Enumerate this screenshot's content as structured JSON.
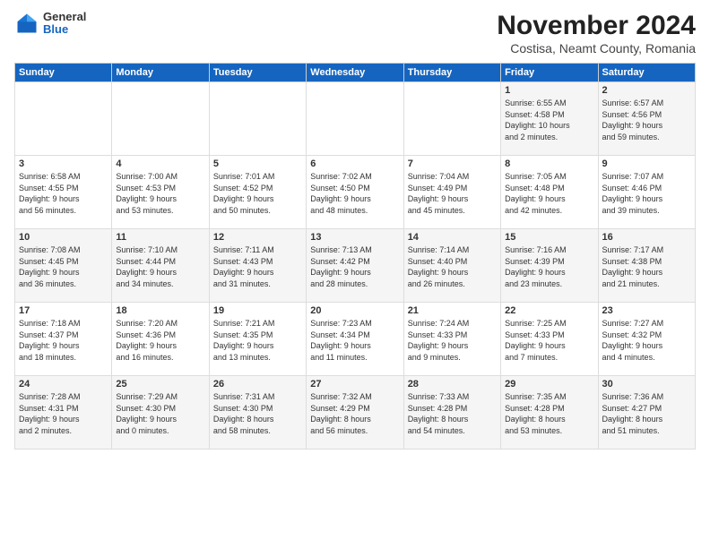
{
  "logo": {
    "general": "General",
    "blue": "Blue"
  },
  "title": "November 2024",
  "subtitle": "Costisa, Neamt County, Romania",
  "headers": [
    "Sunday",
    "Monday",
    "Tuesday",
    "Wednesday",
    "Thursday",
    "Friday",
    "Saturday"
  ],
  "weeks": [
    [
      {
        "day": "",
        "info": ""
      },
      {
        "day": "",
        "info": ""
      },
      {
        "day": "",
        "info": ""
      },
      {
        "day": "",
        "info": ""
      },
      {
        "day": "",
        "info": ""
      },
      {
        "day": "1",
        "info": "Sunrise: 6:55 AM\nSunset: 4:58 PM\nDaylight: 10 hours\nand 2 minutes."
      },
      {
        "day": "2",
        "info": "Sunrise: 6:57 AM\nSunset: 4:56 PM\nDaylight: 9 hours\nand 59 minutes."
      }
    ],
    [
      {
        "day": "3",
        "info": "Sunrise: 6:58 AM\nSunset: 4:55 PM\nDaylight: 9 hours\nand 56 minutes."
      },
      {
        "day": "4",
        "info": "Sunrise: 7:00 AM\nSunset: 4:53 PM\nDaylight: 9 hours\nand 53 minutes."
      },
      {
        "day": "5",
        "info": "Sunrise: 7:01 AM\nSunset: 4:52 PM\nDaylight: 9 hours\nand 50 minutes."
      },
      {
        "day": "6",
        "info": "Sunrise: 7:02 AM\nSunset: 4:50 PM\nDaylight: 9 hours\nand 48 minutes."
      },
      {
        "day": "7",
        "info": "Sunrise: 7:04 AM\nSunset: 4:49 PM\nDaylight: 9 hours\nand 45 minutes."
      },
      {
        "day": "8",
        "info": "Sunrise: 7:05 AM\nSunset: 4:48 PM\nDaylight: 9 hours\nand 42 minutes."
      },
      {
        "day": "9",
        "info": "Sunrise: 7:07 AM\nSunset: 4:46 PM\nDaylight: 9 hours\nand 39 minutes."
      }
    ],
    [
      {
        "day": "10",
        "info": "Sunrise: 7:08 AM\nSunset: 4:45 PM\nDaylight: 9 hours\nand 36 minutes."
      },
      {
        "day": "11",
        "info": "Sunrise: 7:10 AM\nSunset: 4:44 PM\nDaylight: 9 hours\nand 34 minutes."
      },
      {
        "day": "12",
        "info": "Sunrise: 7:11 AM\nSunset: 4:43 PM\nDaylight: 9 hours\nand 31 minutes."
      },
      {
        "day": "13",
        "info": "Sunrise: 7:13 AM\nSunset: 4:42 PM\nDaylight: 9 hours\nand 28 minutes."
      },
      {
        "day": "14",
        "info": "Sunrise: 7:14 AM\nSunset: 4:40 PM\nDaylight: 9 hours\nand 26 minutes."
      },
      {
        "day": "15",
        "info": "Sunrise: 7:16 AM\nSunset: 4:39 PM\nDaylight: 9 hours\nand 23 minutes."
      },
      {
        "day": "16",
        "info": "Sunrise: 7:17 AM\nSunset: 4:38 PM\nDaylight: 9 hours\nand 21 minutes."
      }
    ],
    [
      {
        "day": "17",
        "info": "Sunrise: 7:18 AM\nSunset: 4:37 PM\nDaylight: 9 hours\nand 18 minutes."
      },
      {
        "day": "18",
        "info": "Sunrise: 7:20 AM\nSunset: 4:36 PM\nDaylight: 9 hours\nand 16 minutes."
      },
      {
        "day": "19",
        "info": "Sunrise: 7:21 AM\nSunset: 4:35 PM\nDaylight: 9 hours\nand 13 minutes."
      },
      {
        "day": "20",
        "info": "Sunrise: 7:23 AM\nSunset: 4:34 PM\nDaylight: 9 hours\nand 11 minutes."
      },
      {
        "day": "21",
        "info": "Sunrise: 7:24 AM\nSunset: 4:33 PM\nDaylight: 9 hours\nand 9 minutes."
      },
      {
        "day": "22",
        "info": "Sunrise: 7:25 AM\nSunset: 4:33 PM\nDaylight: 9 hours\nand 7 minutes."
      },
      {
        "day": "23",
        "info": "Sunrise: 7:27 AM\nSunset: 4:32 PM\nDaylight: 9 hours\nand 4 minutes."
      }
    ],
    [
      {
        "day": "24",
        "info": "Sunrise: 7:28 AM\nSunset: 4:31 PM\nDaylight: 9 hours\nand 2 minutes."
      },
      {
        "day": "25",
        "info": "Sunrise: 7:29 AM\nSunset: 4:30 PM\nDaylight: 9 hours\nand 0 minutes."
      },
      {
        "day": "26",
        "info": "Sunrise: 7:31 AM\nSunset: 4:30 PM\nDaylight: 8 hours\nand 58 minutes."
      },
      {
        "day": "27",
        "info": "Sunrise: 7:32 AM\nSunset: 4:29 PM\nDaylight: 8 hours\nand 56 minutes."
      },
      {
        "day": "28",
        "info": "Sunrise: 7:33 AM\nSunset: 4:28 PM\nDaylight: 8 hours\nand 54 minutes."
      },
      {
        "day": "29",
        "info": "Sunrise: 7:35 AM\nSunset: 4:28 PM\nDaylight: 8 hours\nand 53 minutes."
      },
      {
        "day": "30",
        "info": "Sunrise: 7:36 AM\nSunset: 4:27 PM\nDaylight: 8 hours\nand 51 minutes."
      }
    ]
  ]
}
